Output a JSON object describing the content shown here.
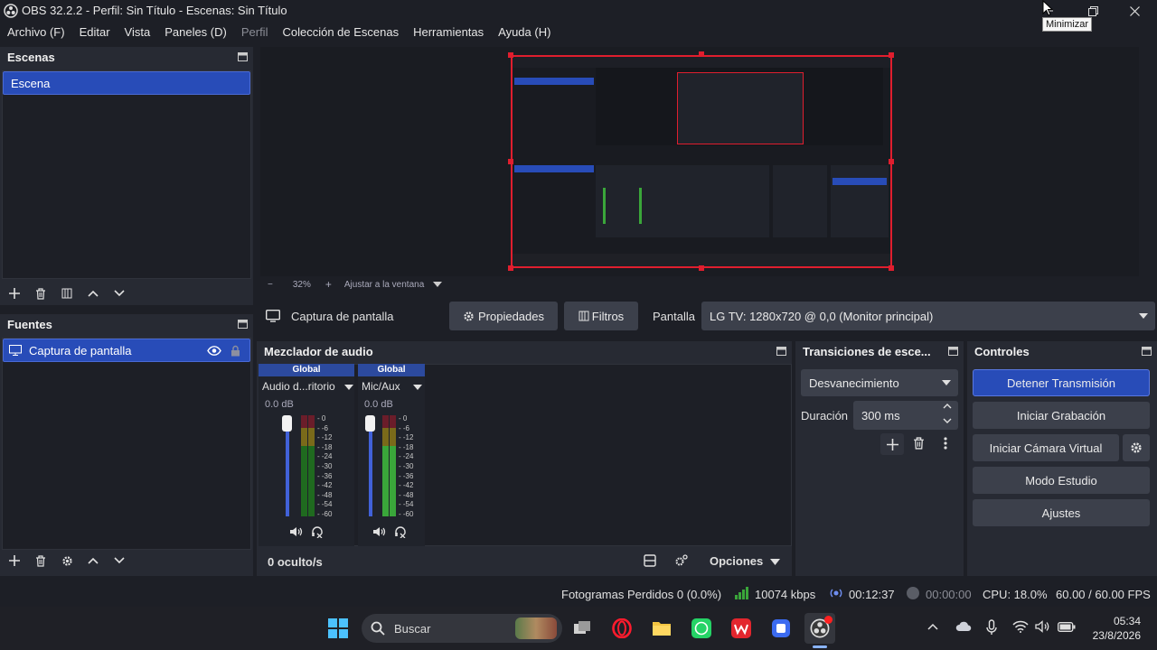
{
  "window": {
    "title": "OBS 32.2.2 - Perfil: Sin Título - Escenas: Sin Título",
    "tooltip": "Minimizar"
  },
  "menu": [
    "Archivo (F)",
    "Editar",
    "Vista",
    "Paneles (D)",
    "Perfil",
    "Colección de Escenas",
    "Herramientas",
    "Ayuda (H)"
  ],
  "scenes": {
    "title": "Escenas",
    "items": [
      "Escena"
    ]
  },
  "sources": {
    "title": "Fuentes",
    "items": [
      "Captura de pantalla"
    ]
  },
  "preview": {
    "zoom": "32%",
    "fit_label": "Ajustar a la ventana"
  },
  "source_toolbar": {
    "source_name": "Captura de pantalla",
    "properties_label": "Propiedades",
    "filters_label": "Filtros",
    "display_label": "Pantalla",
    "display_value": "LG TV: 1280x720 @ 0,0 (Monitor principal)"
  },
  "mixer": {
    "title": "Mezclador de audio",
    "channels": [
      {
        "scope": "Global",
        "name": "Audio d...ritorio",
        "db": "0.0 dB"
      },
      {
        "scope": "Global",
        "name": "Mic/Aux",
        "db": "0.0 dB"
      }
    ],
    "ticks": [
      "0",
      "-6",
      "-12",
      "-18",
      "-24",
      "-30",
      "-36",
      "-42",
      "-48",
      "-54",
      "-60"
    ],
    "footer_label": "0 oculto/s",
    "options_label": "Opciones"
  },
  "transitions": {
    "title": "Transiciones de esce...",
    "selected": "Desvanecimiento",
    "duration_label": "Duración",
    "duration_value": "300 ms"
  },
  "controls": {
    "title": "Controles",
    "stop_stream": "Detener Transmisión",
    "start_recording": "Iniciar Grabación",
    "start_virtual_cam": "Iniciar Cámara Virtual",
    "studio_mode": "Modo Estudio",
    "settings": "Ajustes"
  },
  "status": {
    "dropped_frames": "Fotogramas Perdidos 0 (0.0%)",
    "bitrate": "10074 kbps",
    "stream_time": "00:12:37",
    "record_time": "00:00:00",
    "cpu": "CPU: 18.0%",
    "fps": "60.00 / 60.00 FPS"
  },
  "taskbar": {
    "search_placeholder": "Buscar",
    "time": "05:34",
    "date": "23/8/2026"
  },
  "colors": {
    "accent": "#284cb8",
    "preview_border": "#e01e2e",
    "meter_green": "#3aa63a"
  }
}
